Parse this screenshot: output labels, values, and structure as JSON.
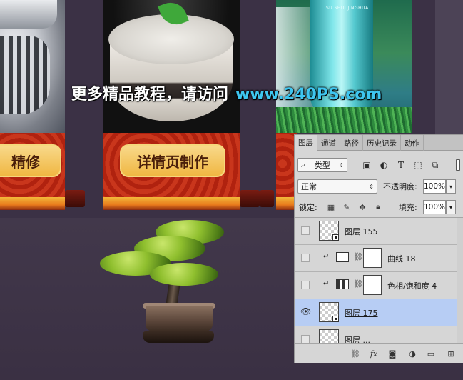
{
  "artwork": {
    "banner_left_text": "精修",
    "banner_middle_text": "详情页制作",
    "bottle_brand": "SU SHUI JINGHUA"
  },
  "watermark": {
    "chinese": "更多精品教程，请访问",
    "url": "www.240PS.com",
    "url_color": "#3ec6f0"
  },
  "layers_panel": {
    "tabs": [
      "图层",
      "通道",
      "路径",
      "历史记录",
      "动作"
    ],
    "filter": {
      "selected": "类型",
      "prefix_icon": "search-icon"
    },
    "filter_icons": [
      "image-filter-icon",
      "adjustment-filter-icon",
      "type-filter-icon",
      "shape-filter-icon",
      "smart-object-filter-icon"
    ],
    "blend_mode": "正常",
    "opacity_label": "不透明度:",
    "opacity_value": "100%",
    "lock_label": "锁定:",
    "fill_label": "填充:",
    "fill_value": "100%",
    "layers": [
      {
        "name": "图层 155",
        "type": "smart-object",
        "visible": false,
        "selected": false
      },
      {
        "name": "曲线 18",
        "type": "adjustment-curves",
        "visible": false,
        "selected": false,
        "clipped": true
      },
      {
        "name": "色相/饱和度 4",
        "type": "adjustment-hue-saturation",
        "visible": false,
        "selected": false,
        "clipped": true
      },
      {
        "name": "图层 175",
        "type": "smart-object",
        "visible": true,
        "selected": true
      },
      {
        "name": "图层 ...",
        "type": "smart-object",
        "visible": false,
        "selected": false
      }
    ],
    "selection_color": "#b7cdf4",
    "footer_icons": [
      "link-layers-icon",
      "fx-icon",
      "layer-mask-icon",
      "adjustment-layer-icon",
      "group-folder-icon",
      "new-layer-icon"
    ],
    "fx_label": "fx"
  }
}
